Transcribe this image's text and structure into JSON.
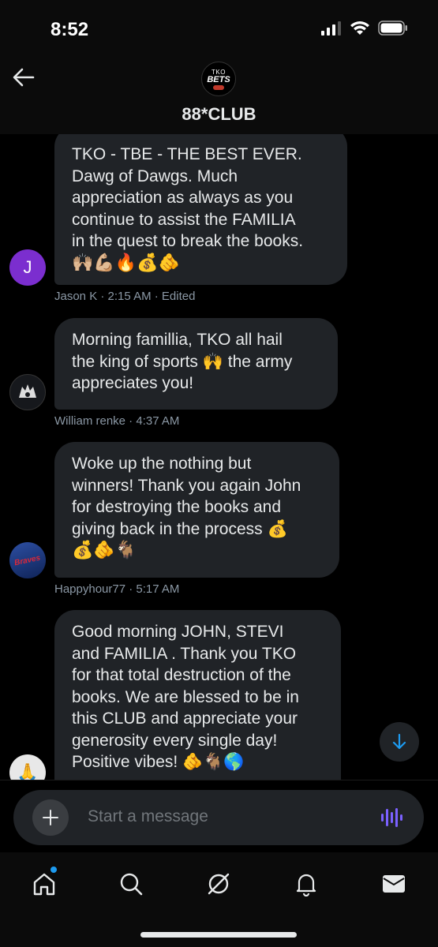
{
  "status_bar": {
    "time": "8:52",
    "icons": [
      "cellular-icon",
      "wifi-icon",
      "battery-icon"
    ]
  },
  "header": {
    "avatar_text_top": "TKO",
    "avatar_text_main": "BETS",
    "title": "88*CLUB"
  },
  "messages": [
    {
      "lines": [
        "TKO - TBE - THE BEST EVER.",
        "Dawg of Dawgs. Much",
        "appreciation as always as you",
        "continue to assist the FAMILIA",
        "in the quest to break the books."
      ],
      "emoji_line": "🙌🏼💪🏼🔥💰🫵",
      "author": "Jason K",
      "meta": "Jason K · 2:15 AM · Edited",
      "avatar_letter": "J",
      "avatar_color": "#7b2ecf"
    },
    {
      "lines": [
        "Morning famillia, TKO all hail",
        "the king of sports 🙌 the army",
        "appreciates you!"
      ],
      "emoji_line": "",
      "author": "William renke",
      "meta": "William renke · 4:37 AM"
    },
    {
      "lines": [
        "Woke up the nothing but",
        "winners! Thank you again John",
        "for destroying the books and",
        "giving back in the process 💰"
      ],
      "emoji_line": "💰🫵🐐",
      "author": "Happyhour77",
      "meta": "Happyhour77 · 5:17 AM"
    },
    {
      "lines": [
        "Good morning JOHN, STEVI",
        "and FAMILIA . Thank you TKO",
        "for that total destruction of the",
        "books. We are blessed to be in",
        "this CLUB and appreciate your",
        "generosity every single day!",
        "Positive vibes! 🫵🐐🌎"
      ],
      "emoji_line": "",
      "author": "",
      "meta": ""
    }
  ],
  "composer": {
    "placeholder": "Start a message"
  },
  "tabs": [
    "home-tab",
    "search-tab",
    "grok-tab",
    "notifications-tab",
    "messages-tab"
  ],
  "colors": {
    "bubble": "#202327",
    "meta_text": "#8b98a5",
    "accent": "#1d9bf0",
    "voice": "#7b61ff"
  }
}
